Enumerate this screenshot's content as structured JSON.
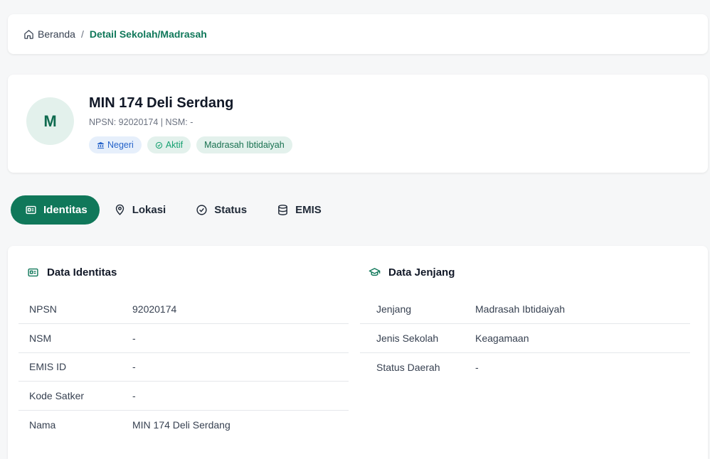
{
  "breadcrumb": {
    "home": "Beranda",
    "separator": "/",
    "current": "Detail Sekolah/Madrasah"
  },
  "school": {
    "avatar_letter": "M",
    "name": "MIN 174 Deli Serdang",
    "subtitle": "NPSN: 92020174 | NSM: -",
    "badges": {
      "status_type": "Negeri",
      "active": "Aktif",
      "jenjang": "Madrasah Ibtidaiyah"
    }
  },
  "tabs": [
    {
      "label": "Identitas",
      "icon": "id-card-icon",
      "active": true
    },
    {
      "label": "Lokasi",
      "icon": "map-pin-icon",
      "active": false
    },
    {
      "label": "Status",
      "icon": "check-circle-icon",
      "active": false
    },
    {
      "label": "EMIS",
      "icon": "database-icon",
      "active": false
    }
  ],
  "identitas": {
    "title": "Data Identitas",
    "rows": [
      {
        "key": "NPSN",
        "value": "92020174"
      },
      {
        "key": "NSM",
        "value": "-"
      },
      {
        "key": "EMIS ID",
        "value": "-"
      },
      {
        "key": "Kode Satker",
        "value": "-"
      },
      {
        "key": "Nama",
        "value": "MIN 174 Deli Serdang"
      }
    ]
  },
  "jenjang": {
    "title": "Data Jenjang",
    "rows": [
      {
        "key": "Jenjang",
        "value": "Madrasah Ibtidaiyah"
      },
      {
        "key": "Jenis Sekolah",
        "value": "Keagamaan"
      },
      {
        "key": "Status Daerah",
        "value": "-"
      }
    ]
  },
  "colors": {
    "primary": "#10785a",
    "badge_blue": "#2563c9",
    "badge_green": "#15a070"
  }
}
